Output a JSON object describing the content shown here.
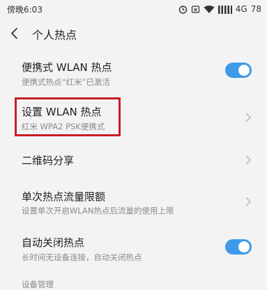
{
  "status_bar": {
    "time": "傍晚6:03",
    "network": "4G",
    "battery": "78",
    "icons": [
      "alarm-icon",
      "mute-icon",
      "wifi-icon",
      "signal-icon",
      "battery-icon"
    ]
  },
  "header": {
    "title": "个人热点",
    "back_icon": "chevron-left-icon"
  },
  "settings": [
    {
      "title": "便携式 WLAN 热点",
      "subtitle": "便携式热点“红米”已激活",
      "control": "toggle",
      "enabled": true
    },
    {
      "title": "设置 WLAN 热点",
      "subtitle": "红米 WPA2 PSK便携式",
      "control": "chevron"
    },
    {
      "title": "二维码分享",
      "subtitle": "",
      "control": "chevron"
    },
    {
      "title": "单次热点流量限额",
      "subtitle": "设置单次开启WLAN热点后流量的使用上限",
      "control": "chevron"
    },
    {
      "title": "自动关闭热点",
      "subtitle": "长时间无设备连接，自动关闭热点",
      "control": "toggle",
      "enabled": true
    }
  ],
  "section": {
    "label": "设备管理"
  },
  "colors": {
    "background": "#f3f3f3",
    "accent": "#3d9ae8",
    "highlight": "#c81e23",
    "subtitle": "#8a8a8a"
  }
}
